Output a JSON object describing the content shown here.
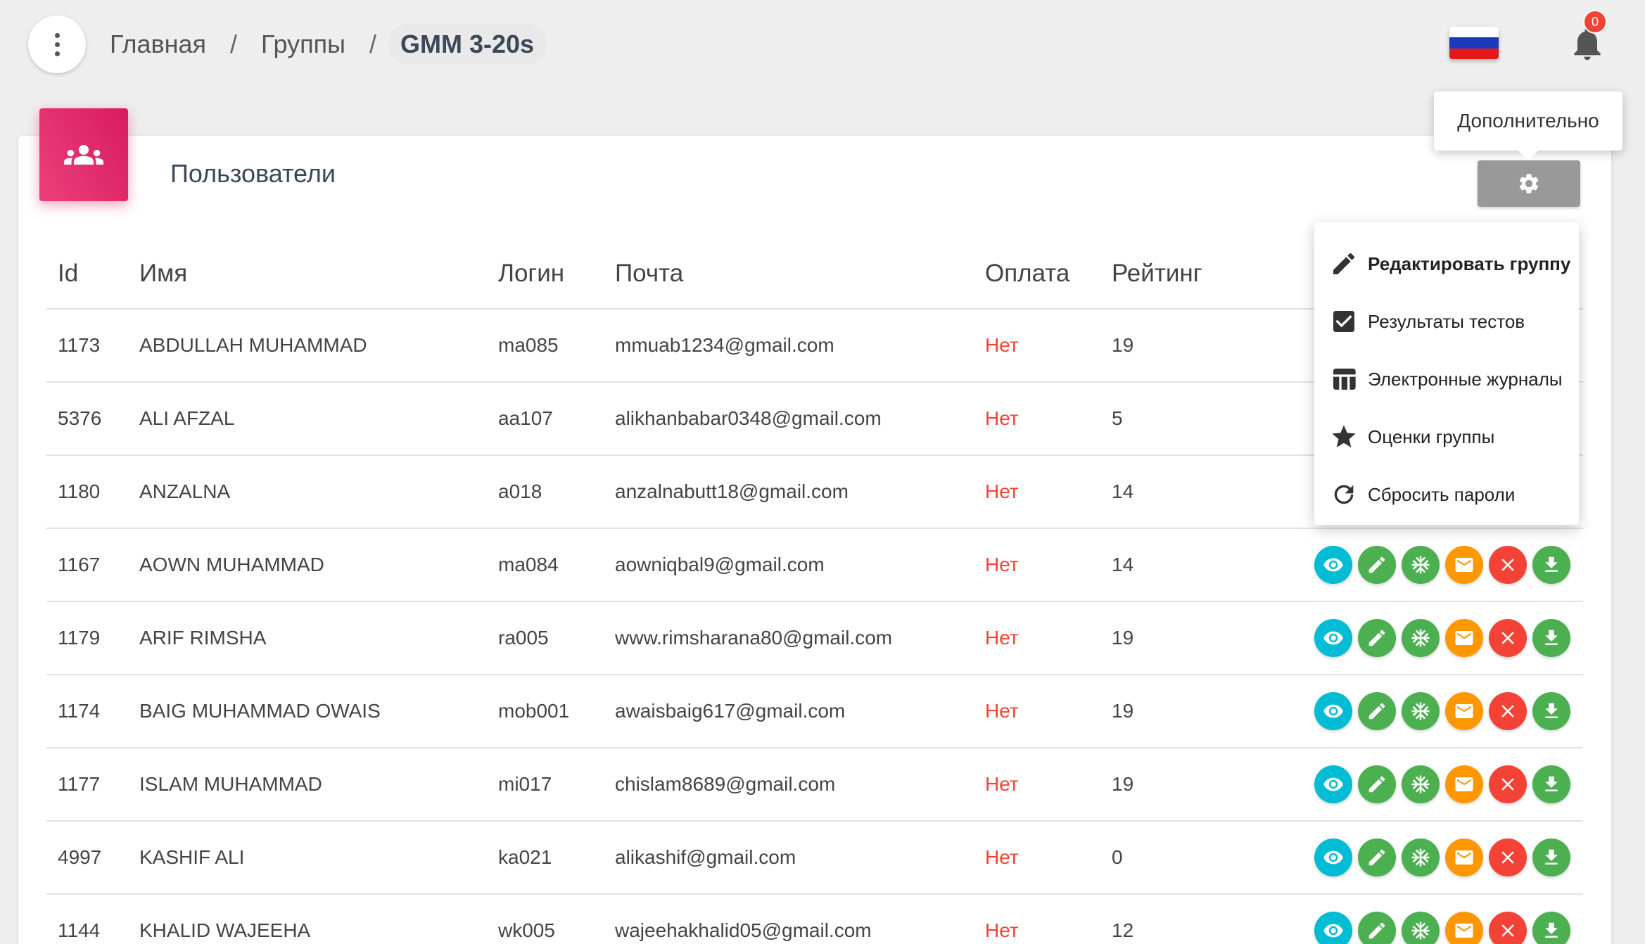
{
  "breadcrumb": {
    "home": "Главная",
    "groups": "Группы",
    "current": "GMM 3-20s",
    "separator": "/"
  },
  "notifications": {
    "count": "0"
  },
  "flag": {
    "name": "russian-flag",
    "colors": [
      "#ffffff",
      "#1c39bb",
      "#e4181c"
    ]
  },
  "card": {
    "title": "Пользователи",
    "icon": "users-icon",
    "accent": "#e91e63"
  },
  "settings": {
    "tooltip": "Дополнительно",
    "icon": "gear-icon"
  },
  "dropdown": {
    "items": [
      {
        "label": "Редактировать группу",
        "icon": "pencil-icon"
      },
      {
        "label": "Результаты тестов",
        "icon": "checkbox-icon"
      },
      {
        "label": "Электронные журналы",
        "icon": "table-icon"
      },
      {
        "label": "Оценки группы",
        "icon": "star-icon"
      },
      {
        "label": "Сбросить пароли",
        "icon": "refresh-icon"
      }
    ]
  },
  "table": {
    "headers": [
      "Id",
      "Имя",
      "Логин",
      "Почта",
      "Оплата",
      "Рейтинг"
    ],
    "rows": [
      {
        "id": "1173",
        "name": "ABDULLAH MUHAMMAD",
        "login": "ma085",
        "email": "mmuab1234@gmail.com",
        "payment": "Нет",
        "rating": "19"
      },
      {
        "id": "5376",
        "name": "ALI AFZAL",
        "login": "aa107",
        "email": "alikhanbabar0348@gmail.com",
        "payment": "Нет",
        "rating": "5"
      },
      {
        "id": "1180",
        "name": "ANZALNA",
        "login": "a018",
        "email": "anzalnabutt18@gmail.com",
        "payment": "Нет",
        "rating": "14"
      },
      {
        "id": "1167",
        "name": "AOWN MUHAMMAD",
        "login": "ma084",
        "email": "aowniqbal9@gmail.com",
        "payment": "Нет",
        "rating": "14"
      },
      {
        "id": "1179",
        "name": "ARIF RIMSHA",
        "login": "ra005",
        "email": "www.rimsharana80@gmail.com",
        "payment": "Нет",
        "rating": "19"
      },
      {
        "id": "1174",
        "name": "BAIG MUHAMMAD OWAIS",
        "login": "mob001",
        "email": "awaisbaig617@gmail.com",
        "payment": "Нет",
        "rating": "19"
      },
      {
        "id": "1177",
        "name": "ISLAM MUHAMMAD",
        "login": "mi017",
        "email": "chislam8689@gmail.com",
        "payment": "Нет",
        "rating": "19"
      },
      {
        "id": "4997",
        "name": "KASHIF ALI",
        "login": "ka021",
        "email": "alikashif@gmail.com",
        "payment": "Нет",
        "rating": "0"
      },
      {
        "id": "1144",
        "name": "KHALID WAJEEHA",
        "login": "wk005",
        "email": "wajeehakhalid05@gmail.com",
        "payment": "Нет",
        "rating": "12"
      }
    ],
    "row_actions": [
      "eye-icon",
      "pencil-icon",
      "snowflake-icon",
      "mail-icon",
      "close-icon",
      "download-icon"
    ]
  },
  "colors": {
    "payment_no": "#f44336",
    "view": "#00bcd4",
    "edit": "#4caf50",
    "mail": "#ff9800",
    "delete": "#f44336"
  }
}
